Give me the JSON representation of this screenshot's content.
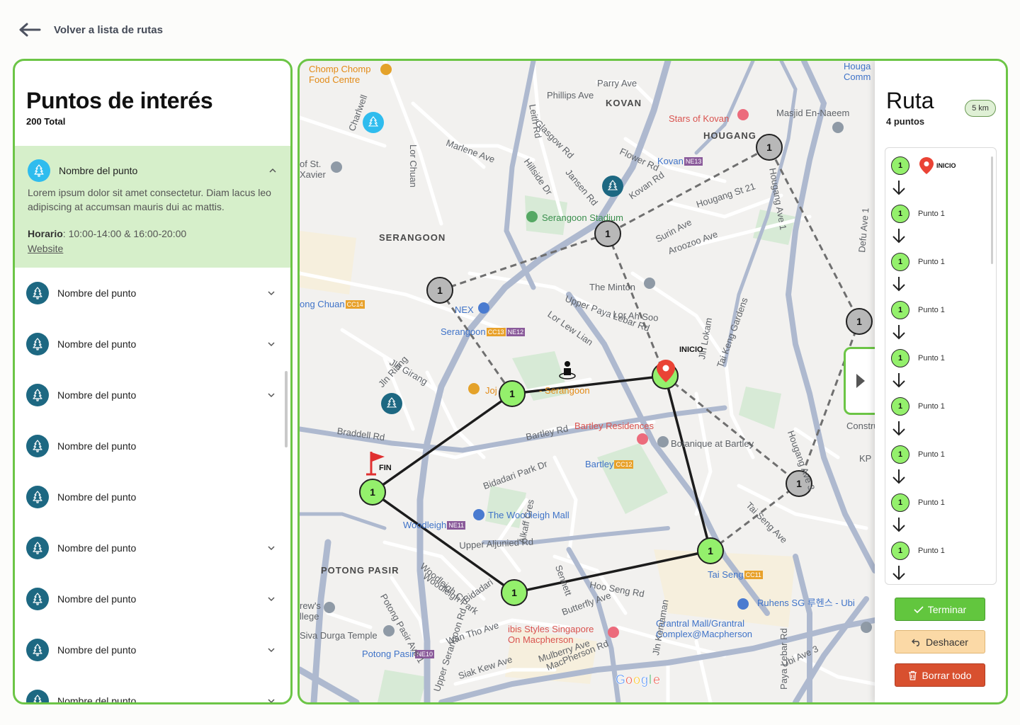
{
  "nav": {
    "back_label": "Volver a lista de rutas"
  },
  "poi_panel": {
    "title": "Puntos de interés",
    "total": "200 Total",
    "expanded": {
      "name": "Nombre del punto",
      "description": "Lorem ipsum dolor sit amet consectetur. Diam lacus leo adipiscing at accumsan mauris dui ac mattis.",
      "hours_label": "Horario",
      "hours_value": ": 10:00-14:00 & 16:00-20:00",
      "website": "Website"
    },
    "items": [
      {
        "name": "Nombre del punto",
        "chevron": true
      },
      {
        "name": "Nombre del punto",
        "chevron": true
      },
      {
        "name": "Nombre del punto",
        "chevron": true
      },
      {
        "name": "Nombre del punto",
        "chevron": false
      },
      {
        "name": "Nombre del punto",
        "chevron": false
      },
      {
        "name": "Nombre del punto",
        "chevron": true
      },
      {
        "name": "Nombre del punto",
        "chevron": true
      },
      {
        "name": "Nombre del punto",
        "chevron": true
      },
      {
        "name": "Nombre del punto",
        "chevron": true
      }
    ],
    "icon": "tree-icon"
  },
  "map": {
    "districts": [
      "KOVAN",
      "HOUGANG",
      "SERANGOON",
      "POTONG PASIR"
    ],
    "places": {
      "chomp": "Chomp Chomp\nFood Centre",
      "stars": "Stars of Kovan",
      "masjid": "Masjid En-Naeem",
      "kovan": "Kovan",
      "kovan_code": "NE13",
      "stadium": "Serangoon Stadium",
      "minton": "The Minton",
      "nex": "NEX",
      "serangoon_stn": "Serangoon",
      "serangoon_cc": "CC13",
      "serangoon_ne": "NE12",
      "lorong_chuan": "ong Chuan",
      "lorong_cc": "CC14",
      "jojo": "Joj",
      "jojo_rest": "- Serangoon",
      "bartley_res": "Bartley Residences",
      "botanique": "Botanique at Bartley",
      "bartley_stn": "Bartley",
      "bartley_cc": "CC12",
      "woodleigh_mall": "The Woodleigh Mall",
      "woodleigh_stn": "Woodleigh",
      "woodleigh_ne": "NE11",
      "tai_seng": "Tai Seng",
      "tai_seng_cc": "CC11",
      "ruhens": "Ruhens SG 루헨스 - Ubi",
      "grantral": "Grantral Mall/Grantral\nComplex@Macpherson",
      "ibis": "ibis Styles Singapore\nOn Macpherson",
      "durga": "Siva Durga Temple",
      "potong_stn": "Potong Pasir",
      "potong_ne": "NE10",
      "hougang_top": "Houga\nComm",
      "construct": "Constru",
      "kp": "KP",
      "xavier": "of St.\nXavier",
      "college": "rew's\nllege",
      "google": "Google"
    },
    "streets": [
      "Parry Ave",
      "Phillips Ave",
      "Flower Rd",
      "Kovan Rd",
      "Hougang St 21",
      "Surin Ave",
      "Aroozoo Ave",
      "Upper Paya Lebar Rd",
      "Lor Ah Soo",
      "Lor Lew Lian",
      "Bartley Rd",
      "Braddell Rd",
      "Jln Girang",
      "Jln Riang",
      "Upper Aljunied Rd",
      "Tai Seng Ave",
      "Hougang Ave 3",
      "Jln Lokam",
      "Tai Keng Gardens",
      "Alkaff Cres",
      "Bidadari Park Dr",
      "Butterfly Ave",
      "Wan Tho Ave",
      "Mulberry Ave",
      "MacPherson Rd",
      "Siak Kew Ave",
      "Ubi Ave 3",
      "Paya Lebar Rd",
      "Upper Serangoon Rd",
      "Lor Chuan",
      "Marlene Ave",
      "Hillside Dr",
      "Leith Rd",
      "Glasgow Rd",
      "Jansen Rd",
      "Defu Ave 1",
      "Hougang Ave 1",
      "Charlwell",
      "Bidadari",
      "Woodleigh Cl",
      "Potong Pasir Ave 1",
      "Woodleigh Park",
      "Sennett",
      "Jln Kemaman",
      "Hoo Seng Rd"
    ],
    "labels": {
      "inicio": "INICIO",
      "fin": "FIN",
      "node": "1"
    }
  },
  "route": {
    "title": "Ruta",
    "count": "4 puntos",
    "distance": "5 km",
    "start_label": "INICIO",
    "steps": [
      "Punto 1",
      "Punto 1",
      "Punto 1",
      "Punto 1",
      "Punto 1",
      "Punto 1",
      "Punto 1",
      "Punto 1"
    ],
    "step_number": "1",
    "buttons": {
      "finish": "Terminar",
      "undo": "Deshacer",
      "clear": "Borrar todo"
    }
  },
  "colors": {
    "accent": "#6cc546",
    "node_active": "#94f06c",
    "node_inactive": "#b8b8b8",
    "poi_icon": "#1d6882",
    "start_pin": "#ea4335",
    "finish": "#62c63e",
    "undo": "#fbd9a6",
    "clear": "#d8502f"
  }
}
